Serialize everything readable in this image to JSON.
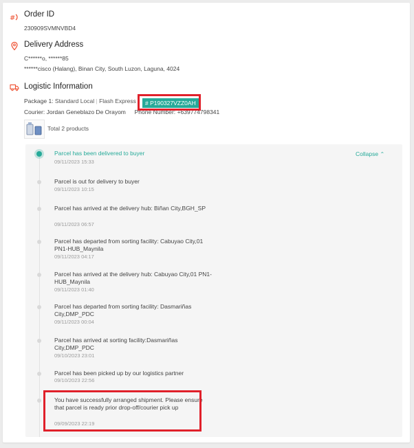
{
  "order": {
    "title": "Order ID",
    "id": "230909SVMNVBD4"
  },
  "delivery": {
    "title": "Delivery Address",
    "name_phone": "C******o, ******85",
    "address": "******cisco (Halang), Binan City, South Luzon, Laguna, 4024"
  },
  "logistics": {
    "title": "Logistic Information",
    "package_label": "Package 1:",
    "shipping_type": "Standard Local",
    "carrier": "Flash Express",
    "tracking": "# P190327VZZ0AH",
    "courier_label": "Courier:",
    "courier_name": "Jordan Geneblazo De Orayom",
    "phone_label": "Phone Number:",
    "phone": "+639774798341",
    "products": "Total 2 products"
  },
  "timeline": {
    "collapse_label": "Collapse",
    "events": [
      {
        "title": "Parcel has been delivered to buyer",
        "time": "09/11/2023 15:33"
      },
      {
        "title": "Parcel is out for delivery to buyer",
        "time": "09/11/2023 10:15"
      },
      {
        "title": "Parcel has arrived at the delivery hub: Biñan City,BGH_SP",
        "time": "09/11/2023 06:57"
      },
      {
        "title": "Parcel has departed from sorting facility: Cabuyao City,01 PN1-HUB_Maynila",
        "time": "09/11/2023 04:17"
      },
      {
        "title": "Parcel has arrived at the delivery hub: Cabuyao City,01 PN1-HUB_Maynila",
        "time": "09/11/2023 01:40"
      },
      {
        "title": "Parcel has departed from sorting facility: Dasmariñas City,DMP_PDC",
        "time": "09/11/2023 00:04"
      },
      {
        "title": "Parcel has arrived at sorting facility:Dasmariñas City,DMP_PDC",
        "time": "09/10/2023 23:01"
      },
      {
        "title": "Parcel has been picked up by our logistics partner",
        "time": "09/10/2023 22:56"
      },
      {
        "title": "You have successfully arranged shipment. Please ensure that parcel is ready prior drop-off/courier pick up",
        "time": "09/09/2023 22:19"
      }
    ]
  },
  "colors": {
    "accent": "#26aa99",
    "brand": "#ee4d2d",
    "highlight": "#e0202a"
  }
}
